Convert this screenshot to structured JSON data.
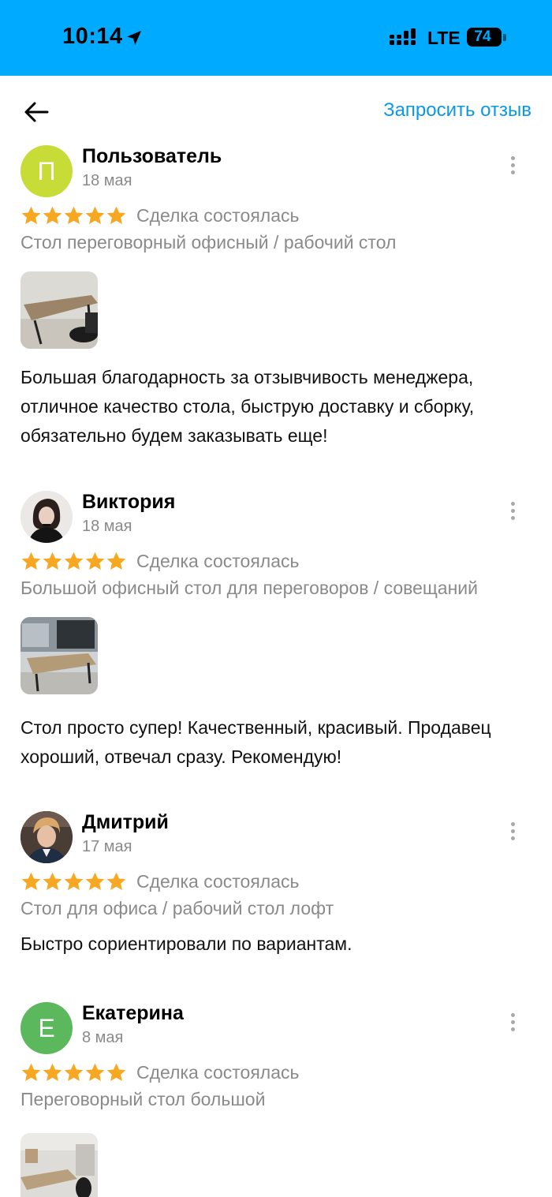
{
  "status": {
    "time": "10:14",
    "network": "LTE",
    "battery": "74"
  },
  "header": {
    "request_review": "Запросить отзыв"
  },
  "reviews": [
    {
      "name": "Пользователь",
      "initial": "П",
      "avatar_color": "#c8dc38",
      "date": "18 мая",
      "deal": "Сделка состоялась",
      "item": "Стол переговорный офисный / рабочий стол",
      "text": "Большая благодарность за отзывчивость менеджера, отличное качество стола, быструю доставку и сборку, обязательно будем заказывать еще!"
    },
    {
      "name": "Виктория",
      "date": "18 мая",
      "deal": "Сделка состоялась",
      "item": "Большой офисный стол для переговоров / совещаний",
      "text": "Стол просто супер! Качественный, красивый. Продавец хороший, отвечал сразу. Рекомендую!"
    },
    {
      "name": "Дмитрий",
      "date": "17 мая",
      "deal": "Сделка состоялась",
      "item": "Стол для офиса / рабочий стол лофт",
      "text": "Быстро сориентировали по вариантам."
    },
    {
      "name": "Екатерина",
      "initial": "Е",
      "avatar_color": "#5cb85c",
      "date": "8 мая",
      "deal": "Сделка состоялась",
      "item": "Переговорный стол большой"
    }
  ],
  "colors": {
    "status_bar": "#00aaff",
    "accent_link": "#0a98e8",
    "star": "#f7a823",
    "muted_text": "#8a8a8a"
  },
  "icons": [
    "location-arrow-icon",
    "signal-icon",
    "battery-icon",
    "back-arrow-icon",
    "more-vertical-icon",
    "star-icon"
  ]
}
